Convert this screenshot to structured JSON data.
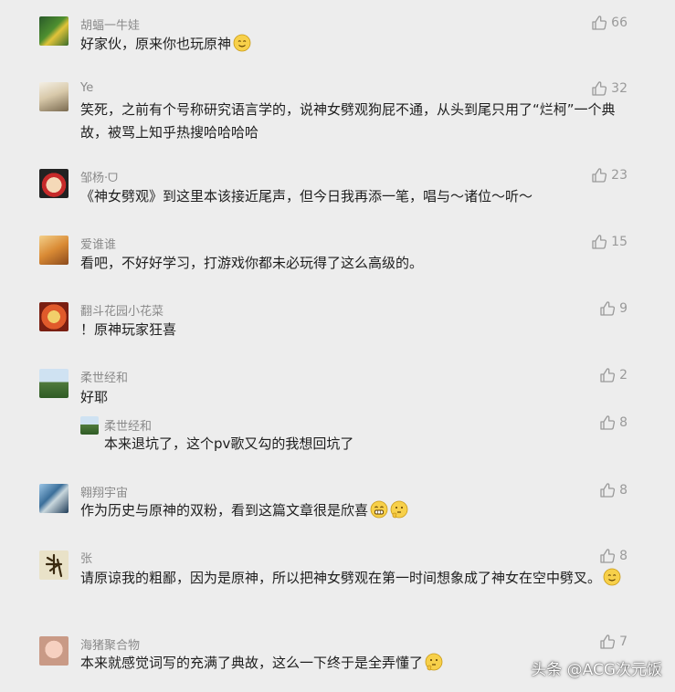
{
  "comments": [
    {
      "name": "胡蝠一牛娃",
      "likes": "66",
      "text": "好家伙，原来你也玩原神"
    },
    {
      "name": "Ye",
      "likes": "32",
      "text": "笑死，之前有个号称研究语言学的，说神女劈观狗屁不通，从头到尾只用了“烂柯”一个典故，被骂上知乎热搜哈哈哈哈"
    },
    {
      "name": "邹杨·⁢ᗜ",
      "likes": "23",
      "text": "《神女劈观》到这里本该接近尾声，但今日我再添一笔，唱与～诸位～听～"
    },
    {
      "name": "爱谁谁",
      "likes": "15",
      "text": "看吧，不好好学习，打游戏你都未必玩得了这么高级的。"
    },
    {
      "name": "翻斗花园小花菜",
      "likes": "9",
      "text": "！原神玩家狂喜"
    },
    {
      "name": "柔世经和",
      "likes": "2",
      "text": "好耶"
    },
    {
      "name": "柔世经和",
      "likes": "8",
      "text": "本来退坑了，这个pv歌又勾的我想回坑了"
    },
    {
      "name": "翱翔宇宙",
      "likes": "8",
      "text": "作为历史与原神的双粉，看到这篇文章很是欣喜"
    },
    {
      "name": "张",
      "likes": "8",
      "text": "请原谅我的粗鄙，因为是原神，所以把神女劈观在第一时间想象成了神女在空中劈叉。"
    },
    {
      "name": "海猪聚合物",
      "likes": "7",
      "text": "本来就感觉词写的充满了典故，这么一下终于是全弄懂了"
    }
  ],
  "watermark": "头条 @ACG次元饭",
  "icons": {
    "like": "thumbs-up-icon",
    "emoji_smile": "smile-emoji-icon",
    "emoji_grin": "grin-emoji-icon",
    "emoji_think": "thinking-emoji-icon"
  }
}
